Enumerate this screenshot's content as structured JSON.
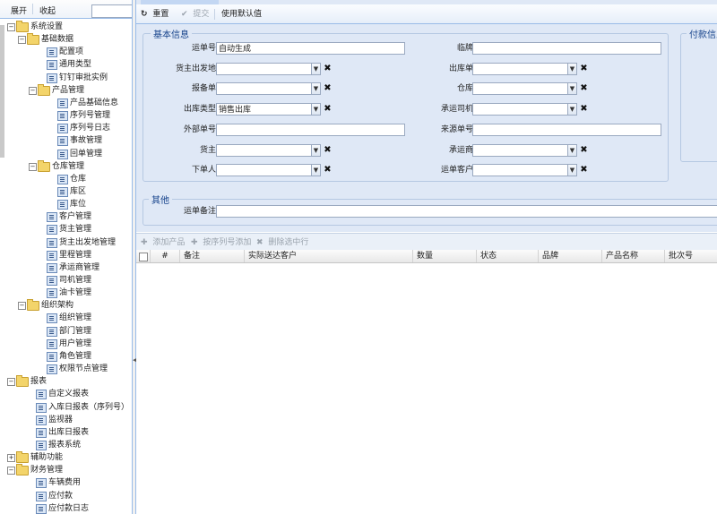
{
  "tree_toolbar": {
    "expand": "展开",
    "collapse": "收起",
    "search_value": ""
  },
  "tree": [
    {
      "label": "系统设置",
      "type": "folder",
      "level": 0,
      "expanded": true
    },
    {
      "label": "基础数据",
      "type": "folder",
      "level": 1,
      "expanded": true
    },
    {
      "label": "配置项",
      "type": "leaf",
      "level": 2
    },
    {
      "label": "通用类型",
      "type": "leaf",
      "level": 2
    },
    {
      "label": "钉钉审批实例",
      "type": "leaf",
      "level": 2
    },
    {
      "label": "产品管理",
      "type": "folder",
      "level": 2,
      "expanded": true
    },
    {
      "label": "产品基础信息",
      "type": "leaf",
      "level": 3
    },
    {
      "label": "序列号管理",
      "type": "leaf",
      "level": 3
    },
    {
      "label": "序列号日志",
      "type": "leaf",
      "level": 3
    },
    {
      "label": "事故管理",
      "type": "leaf",
      "level": 3
    },
    {
      "label": "回单管理",
      "type": "leaf",
      "level": 3
    },
    {
      "label": "仓库管理",
      "type": "folder",
      "level": 2,
      "expanded": true
    },
    {
      "label": "仓库",
      "type": "leaf",
      "level": 3
    },
    {
      "label": "库区",
      "type": "leaf",
      "level": 3
    },
    {
      "label": "库位",
      "type": "leaf",
      "level": 3
    },
    {
      "label": "客户管理",
      "type": "leaf",
      "level": 2
    },
    {
      "label": "货主管理",
      "type": "leaf",
      "level": 2
    },
    {
      "label": "货主出发地管理",
      "type": "leaf",
      "level": 2
    },
    {
      "label": "里程管理",
      "type": "leaf",
      "level": 2
    },
    {
      "label": "承运商管理",
      "type": "leaf",
      "level": 2
    },
    {
      "label": "司机管理",
      "type": "leaf",
      "level": 2
    },
    {
      "label": "油卡管理",
      "type": "leaf",
      "level": 2
    },
    {
      "label": "组织架构",
      "type": "folder",
      "level": 1,
      "expanded": true
    },
    {
      "label": "组织管理",
      "type": "leaf",
      "level": 2
    },
    {
      "label": "部门管理",
      "type": "leaf",
      "level": 2
    },
    {
      "label": "用户管理",
      "type": "leaf",
      "level": 2
    },
    {
      "label": "角色管理",
      "type": "leaf",
      "level": 2
    },
    {
      "label": "权限节点管理",
      "type": "leaf",
      "level": 2
    },
    {
      "label": "报表",
      "type": "folder",
      "level": 0,
      "expanded": true
    },
    {
      "label": "自定义报表",
      "type": "leaf",
      "level": 1
    },
    {
      "label": "入库日报表（序列号）",
      "type": "leaf",
      "level": 1
    },
    {
      "label": "监视器",
      "type": "leaf",
      "level": 1
    },
    {
      "label": "出库日报表",
      "type": "leaf",
      "level": 1
    },
    {
      "label": "报表系统",
      "type": "leaf",
      "level": 1
    },
    {
      "label": "辅助功能",
      "type": "folder",
      "level": 0,
      "expanded": false
    },
    {
      "label": "财务管理",
      "type": "folder",
      "level": 0,
      "expanded": true
    },
    {
      "label": "车辆费用",
      "type": "leaf",
      "level": 1
    },
    {
      "label": "应付款",
      "type": "leaf",
      "level": 1
    },
    {
      "label": "应付款日志",
      "type": "leaf",
      "level": 1
    }
  ],
  "toolbar": {
    "reset": "重置",
    "submit": "提交",
    "use_default": "使用默认值"
  },
  "basic_info": {
    "legend": "基本信息",
    "fields": [
      {
        "label": "运单号:",
        "value": "自动生成",
        "kind": "text"
      },
      {
        "label": "临牌:",
        "value": "",
        "kind": "text"
      },
      {
        "label": "货主出发地:",
        "value": "",
        "kind": "combo"
      },
      {
        "label": "出库单:",
        "value": "",
        "kind": "combo"
      },
      {
        "label": "报备单:",
        "value": "",
        "kind": "combo"
      },
      {
        "label": "仓库:",
        "value": "",
        "kind": "combo"
      },
      {
        "label": "出库类型:",
        "value": "销售出库",
        "kind": "combo"
      },
      {
        "label": "承运司机:",
        "value": "",
        "kind": "combo"
      },
      {
        "label": "外部单号:",
        "value": "",
        "kind": "text"
      },
      {
        "label": "来源单号:",
        "value": "",
        "kind": "text"
      },
      {
        "label": "货主:",
        "value": "",
        "kind": "combo"
      },
      {
        "label": "承运商:",
        "value": "",
        "kind": "combo"
      },
      {
        "label": "下单人:",
        "value": "",
        "kind": "combo"
      },
      {
        "label": "运单客户:",
        "value": "",
        "kind": "combo"
      }
    ]
  },
  "payment_info": {
    "legend": "付款信息"
  },
  "other": {
    "legend": "其他",
    "remark_label": "运单备注:",
    "remark_value": ""
  },
  "grid_toolbar": {
    "add_product": "添加产品",
    "add_by_serial": "按序列号添加",
    "delete_selected": "删除选中行"
  },
  "grid": {
    "columns": [
      "#",
      "备注",
      "实际送达客户",
      "数量",
      "状态",
      "品牌",
      "产品名称",
      "批次号"
    ]
  }
}
